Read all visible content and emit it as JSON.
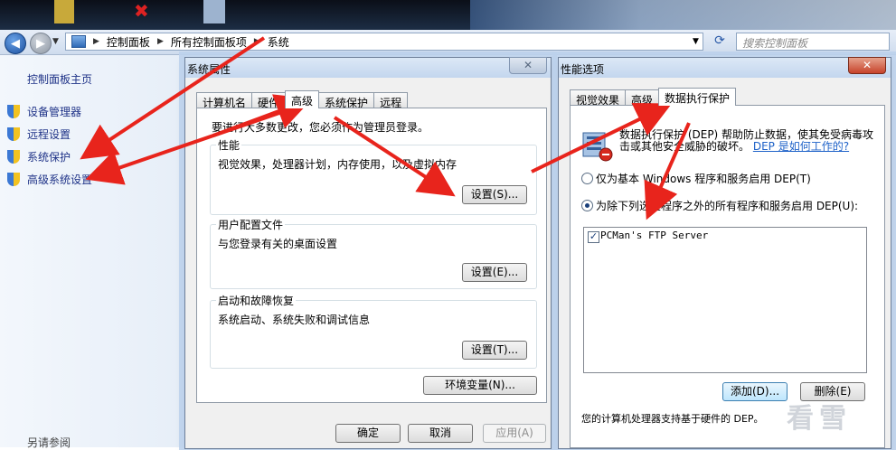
{
  "explorer": {
    "breadcrumb": [
      "控制面板",
      "所有控制面板项",
      "系统"
    ],
    "search_placeholder": "搜索控制面板"
  },
  "left_panel": {
    "home": "控制面板主页",
    "items": [
      "设备管理器",
      "远程设置",
      "系统保护",
      "高级系统设置"
    ],
    "see_also": "另请参阅"
  },
  "system_props": {
    "title": "系统属性",
    "close": "✕",
    "tabs": [
      "计算机名",
      "硬件",
      "高级",
      "系统保护",
      "远程"
    ],
    "admin_note": "要进行大多数更改，您必须作为管理员登录。",
    "perf": {
      "title": "性能",
      "desc": "视觉效果，处理器计划，内存使用，以及虚拟内存",
      "button": "设置(S)..."
    },
    "profile": {
      "title": "用户配置文件",
      "desc": "与您登录有关的桌面设置",
      "button": "设置(E)..."
    },
    "startup": {
      "title": "启动和故障恢复",
      "desc": "系统启动、系统失败和调试信息",
      "button": "设置(T)..."
    },
    "env_button": "环境变量(N)...",
    "ok": "确定",
    "cancel": "取消",
    "apply": "应用(A)"
  },
  "perf_options": {
    "title": "性能选项",
    "close": "✕",
    "tabs": [
      "视觉效果",
      "高级",
      "数据执行保护"
    ],
    "dep_desc": "数据执行保护 (DEP) 帮助防止数据，使其免受病毒攻击或其他安全威胁的破坏。",
    "dep_link": "DEP 是如何工作的?",
    "radio1": "仅为基本 Windows 程序和服务启用 DEP(T)",
    "radio2": "为除下列选定程序之外的所有程序和服务启用 DEP(U):",
    "list_item": "PCMan's FTP Server",
    "add_button": "添加(D)...",
    "remove_button": "删除(E)",
    "hw_note": "您的计算机处理器支持基于硬件的 DEP。"
  },
  "watermark": "看雪",
  "colors": {
    "arrow": "#e8241c",
    "link": "#1e3287"
  }
}
